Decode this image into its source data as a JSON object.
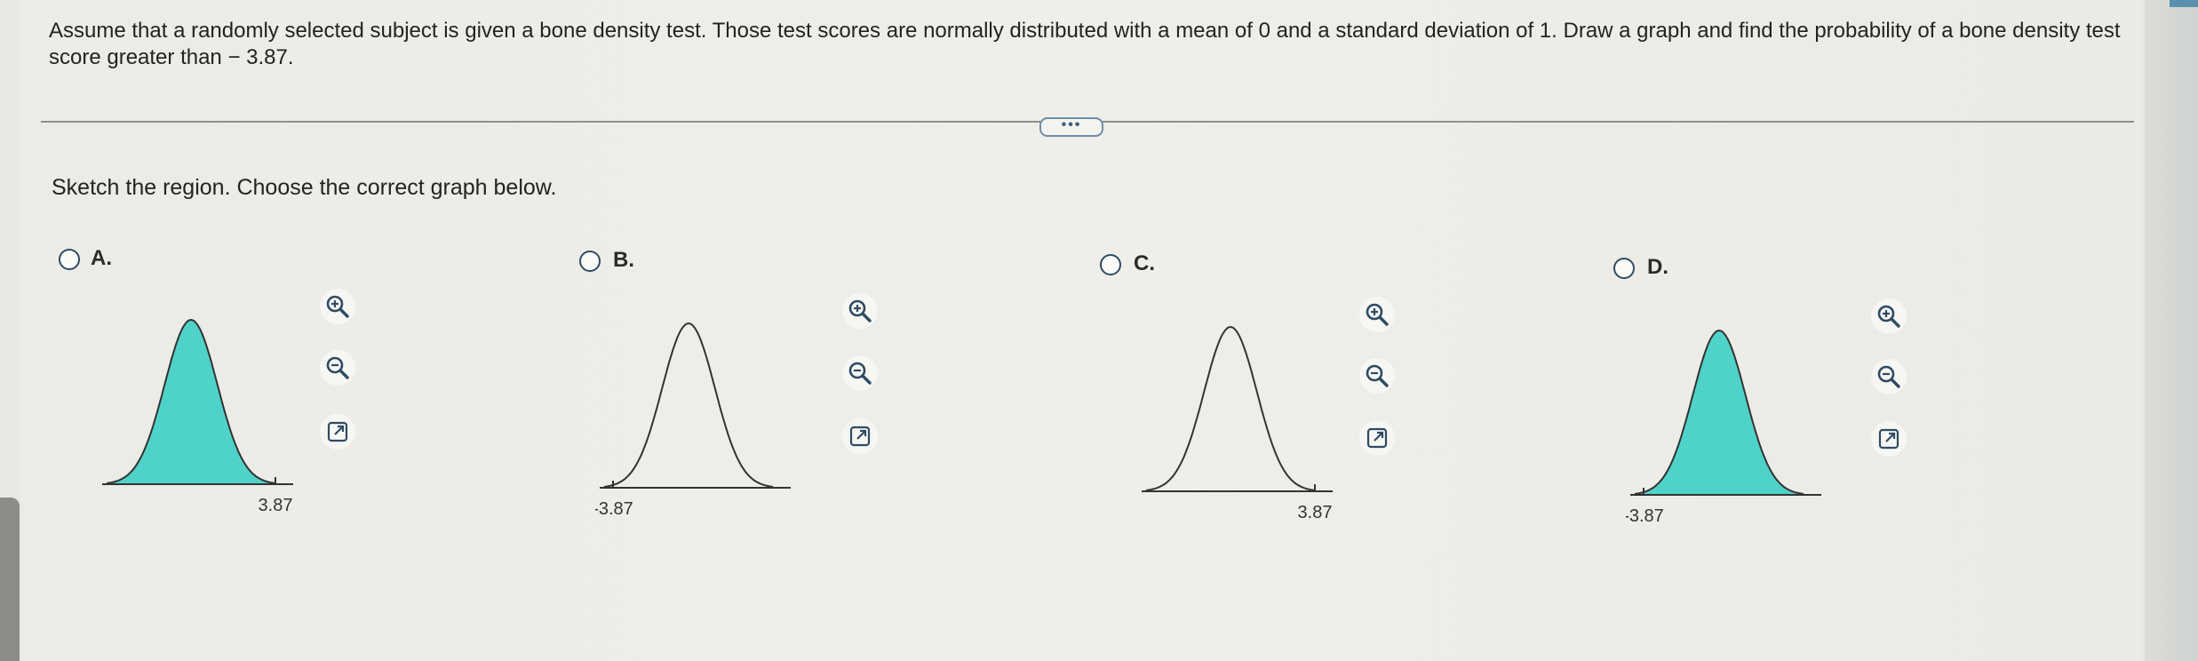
{
  "question": {
    "text": "Assume that a randomly selected subject is given a bone density test. Those test scores are normally distributed with a mean of 0 and a standard deviation of 1. Draw a graph and find the probability of a bone density test score greater than  − 3.87."
  },
  "more_button": {
    "label": "•••"
  },
  "instruction": "Sketch the region. Choose the correct graph below.",
  "options": [
    {
      "id": "A",
      "label": "A.",
      "tick_label": "3.87",
      "shaded": true,
      "tick_side": "right"
    },
    {
      "id": "B",
      "label": "B.",
      "tick_label": "-3.87",
      "shaded": false,
      "tick_side": "left"
    },
    {
      "id": "C",
      "label": "C.",
      "tick_label": "3.87",
      "shaded": false,
      "tick_side": "right"
    },
    {
      "id": "D",
      "label": "D.",
      "tick_label": "-3.87",
      "shaded": true,
      "tick_side": "left"
    }
  ],
  "colors": {
    "shade": "#4fd3c9",
    "curve": "#333333",
    "accent": "#2f4b63"
  },
  "tool_icons": [
    "zoom-in-icon",
    "zoom-out-icon",
    "open-external-icon"
  ]
}
